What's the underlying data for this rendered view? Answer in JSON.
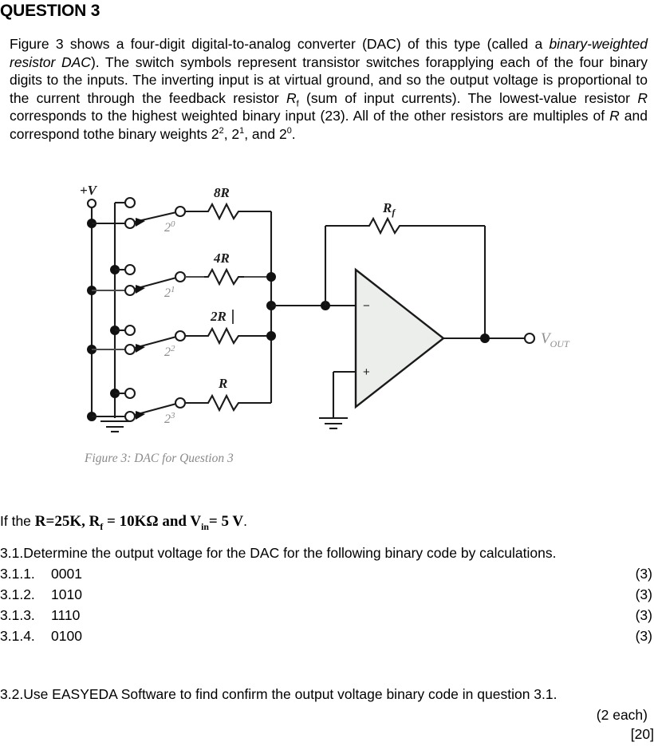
{
  "document": {
    "question_title": "QUESTION 3",
    "intro_paragraph": {
      "part1": "Figure 3 shows a four-digit digital-to-analog converter (DAC) of this type (called a ",
      "italic_term": "binary-weighted resistor DAC",
      "part2": "). The switch symbols represent transistor switches forapplying each of the four binary digits to the inputs. The inverting input is at virtual ground, and so the output voltage is proportional to the current through the feedback resistor ",
      "var_rf": "R",
      "sub_f": "f",
      "part3": " (sum of input currents). The lowest-value resistor ",
      "var_r": "R",
      "part4": " corresponds to the highest weighted binary input (23). All of the other resistors are multiples of ",
      "var_r2": "R",
      "part5": " and correspond tothe binary weights 2",
      "sup_2": "2",
      "part6": ", 2",
      "sup_1": "1",
      "part7": ", and 2",
      "sup_0": "0",
      "part8": "."
    },
    "figure": {
      "caption": "Figure 3: DAC for Question 3",
      "supply_label": "+V",
      "output_label_main": "V",
      "output_label_sub": "OUT",
      "feedback_resistor_label": "R",
      "feedback_resistor_sub": "f",
      "branches": [
        {
          "resistor": "8R",
          "weight_base": "2",
          "weight_exp": "0"
        },
        {
          "resistor": "4R",
          "weight_base": "2",
          "weight_exp": "1"
        },
        {
          "resistor": "2R",
          "weight_base": "2",
          "weight_exp": "2"
        },
        {
          "resistor": "R",
          "weight_base": "2",
          "weight_exp": "3"
        }
      ],
      "opamp_inverting_symbol": "−",
      "opamp_noninverting_symbol": "+"
    },
    "given": {
      "lead": "If the ",
      "values": "R=25K, R",
      "values_sub": "f",
      "values_mid": " =  10KΩ and V",
      "values_sub2": "in",
      "values_end": "= 5 V",
      "period": "."
    },
    "q31": {
      "number": "3.1.",
      "text": "Determine  the  output  voltage  for  the  DAC  for  the  following binary code by calculations."
    },
    "sub_questions": [
      {
        "number": "3.1.1.",
        "code": "0001",
        "marks": "(3)"
      },
      {
        "number": "3.1.2.",
        "code": "1010",
        "marks": "(3)"
      },
      {
        "number": "3.1.3.",
        "code": "1110",
        "marks": "(3)"
      },
      {
        "number": "3.1.4.",
        "code": "0100",
        "marks": "(3)"
      }
    ],
    "q32": {
      "number": "3.2.",
      "text": "Use EASYEDA Software to find confirm the output voltage binary code in question 3.1."
    },
    "marks_each": "(2 each)",
    "marks_total": "[20]"
  }
}
